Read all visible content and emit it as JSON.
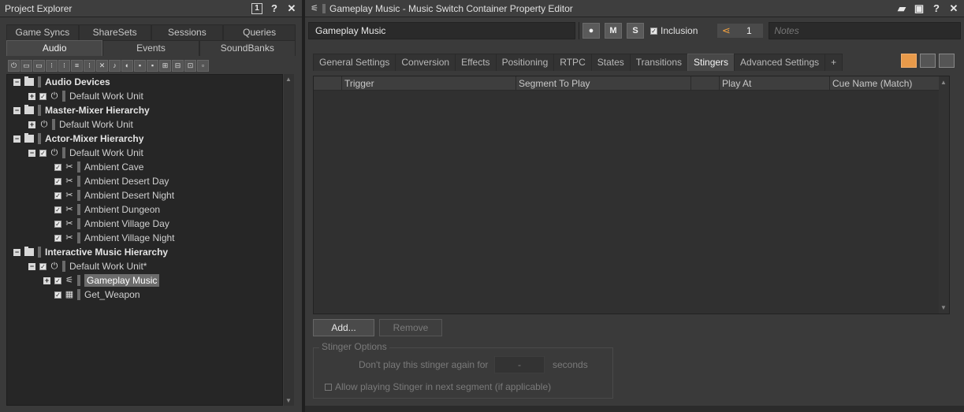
{
  "project_explorer": {
    "title": "Project Explorer",
    "title_buttons": {
      "float": "1",
      "help": "?",
      "close": "✕"
    },
    "tabs_row1": [
      "Game Syncs",
      "ShareSets",
      "Sessions",
      "Queries"
    ],
    "tabs_row2": [
      "Audio",
      "Events",
      "SoundBanks"
    ],
    "active_tab": "Audio",
    "tree": [
      {
        "label": "Audio Devices",
        "bold": true
      },
      {
        "label": "Default Work Unit"
      },
      {
        "label": "Master-Mixer Hierarchy",
        "bold": true
      },
      {
        "label": "Default Work Unit"
      },
      {
        "label": "Actor-Mixer Hierarchy",
        "bold": true
      },
      {
        "label": "Default Work Unit"
      },
      {
        "label": "Ambient Cave"
      },
      {
        "label": "Ambient Desert Day"
      },
      {
        "label": "Ambient Desert Night"
      },
      {
        "label": "Ambient Dungeon"
      },
      {
        "label": "Ambient Village Day"
      },
      {
        "label": "Ambient Village Night"
      },
      {
        "label": "Interactive Music Hierarchy",
        "bold": true
      },
      {
        "label": "Default Work Unit*"
      },
      {
        "label": "Gameplay Music",
        "selected": true
      },
      {
        "label": "Get_Weapon"
      }
    ]
  },
  "editor": {
    "title": "Gameplay Music - Music Switch Container Property Editor",
    "name_value": "Gameplay Music",
    "m_button": "M",
    "s_button": "S",
    "inclusion_label": "Inclusion",
    "share_count": "1",
    "notes_placeholder": "Notes",
    "tabs": [
      "General Settings",
      "Conversion",
      "Effects",
      "Positioning",
      "RTPC",
      "States",
      "Transitions",
      "Stingers",
      "Advanced Settings",
      "+"
    ],
    "active_tab": "Stingers",
    "table_headers": [
      "",
      "Trigger",
      "Segment To Play",
      "",
      "Play At",
      "Cue Name (Match)"
    ],
    "add_label": "Add...",
    "remove_label": "Remove",
    "stinger_options": {
      "title": "Stinger Options",
      "dont_play_label": "Don't play this stinger again for",
      "dont_play_value": "-",
      "seconds_label": "seconds",
      "allow_next_label": "Allow playing Stinger in next segment (if applicable)"
    }
  },
  "colors": {
    "accent_orange": "#e89a4a",
    "background": "#3a3a3a"
  }
}
